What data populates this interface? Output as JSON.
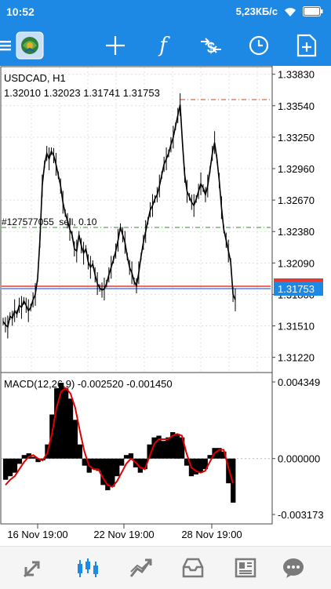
{
  "status_bar": {
    "time": "10:52",
    "network_speed": "5,23КБ/с",
    "battery": "full"
  },
  "toolbar": {
    "icons": [
      "menu-icon",
      "app-logo-icon",
      "crosshair-icon",
      "indicators-icon",
      "trade-icon",
      "clock-icon",
      "new-order-icon"
    ],
    "color": "#1e88e5"
  },
  "chart": {
    "symbol_label": "USDCAD, H1",
    "ohlc_label": "1.32010 1.32023 1.31741 1.31753",
    "order_label": "#127577055  sell, 0.10",
    "price_axis_labels": [
      "1.33830",
      "1.33540",
      "1.33250",
      "1.32960",
      "1.32670",
      "1.32380",
      "1.32090",
      "1.31800",
      "1.31510",
      "1.31220"
    ],
    "current_price": "1.31753",
    "macd_label": "MACD(12,26,9) -0.002520 -0.001450",
    "macd_axis_labels": [
      "0.004349",
      "0.000000",
      "-0.003173"
    ],
    "time_labels": [
      "16 Nov 19:00",
      "22 Nov 19:00",
      "28 Nov 19:00"
    ],
    "colors": {
      "price_line": "#000000",
      "bid_line": "#e53935",
      "ask_line": "#5c7cfa",
      "current_price_bg": "#1e88e5",
      "signal_line": "#e00000",
      "order_line": "#2e8b2e",
      "sl_tp_line": "#d04020"
    }
  },
  "chart_data": [
    {
      "type": "line",
      "title": "USDCAD, H1",
      "xlabel": "",
      "ylabel": "",
      "x_tick_labels": [
        "16 Nov 19:00",
        "22 Nov 19:00",
        "28 Nov 19:00"
      ],
      "ylim": [
        1.3108,
        1.339
      ],
      "series": [
        {
          "values": [
            1.3155,
            1.3152,
            1.315,
            1.316,
            1.3158,
            1.3165,
            1.3162,
            1.317,
            1.3168,
            1.3174,
            1.317,
            1.3165,
            1.3168,
            1.3175,
            1.318,
            1.3195,
            1.323,
            1.328,
            1.33,
            1.331,
            1.3305,
            1.3312,
            1.3308,
            1.33,
            1.329,
            1.328,
            1.3265,
            1.3255,
            1.3248,
            1.324,
            1.3235,
            1.3222,
            1.322,
            1.3235,
            1.3225,
            1.3218,
            1.3222,
            1.321,
            1.3205,
            1.3208,
            1.3198,
            1.319,
            1.3186,
            1.3184,
            1.3185,
            1.319,
            1.3198,
            1.3205,
            1.3212,
            1.322,
            1.323,
            1.3242,
            1.3235,
            1.3228,
            1.3215,
            1.3205,
            1.32,
            1.3192,
            1.3188,
            1.32,
            1.3215,
            1.3228,
            1.3238,
            1.3248,
            1.3258,
            1.3262,
            1.3268,
            1.3272,
            1.328,
            1.329,
            1.33,
            1.3305,
            1.331,
            1.3318,
            1.3325,
            1.3335,
            1.3345,
            1.3355,
            1.332,
            1.329,
            1.3275,
            1.327,
            1.3265,
            1.3262,
            1.3268,
            1.3275,
            1.3282,
            1.3278,
            1.3272,
            1.328,
            1.3295,
            1.331,
            1.332,
            1.3305,
            1.3285,
            1.326,
            1.324,
            1.323,
            1.322,
            1.321,
            1.318,
            1.3175
          ]
        }
      ]
    },
    {
      "type": "bar",
      "title": "MACD(12,26,9)",
      "xlabel": "",
      "ylabel": "",
      "ylim": [
        -0.003173,
        0.004349
      ],
      "series": [
        {
          "name": "MACD",
          "values": [
            -0.0012,
            -0.001,
            -0.0008,
            -0.0003,
            0.0002,
            0.0003,
            0.0001,
            -0.0002,
            -0.0001,
            0.0008,
            0.0025,
            0.004,
            0.0043,
            0.004,
            0.0034,
            0.0022,
            0.0008,
            -0.0004,
            -0.0008,
            -0.0006,
            -0.0007,
            -0.0015,
            -0.0018,
            -0.0016,
            -0.001,
            -0.0004,
            0.0002,
            0.0003,
            -0.0005,
            -0.0008,
            -0.0006,
            0.0008,
            0.0012,
            0.0013,
            0.001,
            0.0012,
            0.0015,
            0.0014,
            0.0012,
            -0.0004,
            -0.001,
            -0.0009,
            -0.0008,
            -0.0006,
            0.0002,
            0.0006,
            0.0006,
            0.0004,
            -0.0014,
            -0.0025
          ]
        },
        {
          "name": "Signal",
          "values": [
            -0.0015,
            -0.0012,
            -0.001,
            -0.0006,
            -0.0002,
            0.0001,
            0.0002,
            0.0,
            -0.0001,
            0.0003,
            0.0014,
            0.0029,
            0.0038,
            0.004,
            0.0037,
            0.0029,
            0.0016,
            0.0004,
            -0.0004,
            -0.0006,
            -0.0006,
            -0.0011,
            -0.0015,
            -0.0016,
            -0.0013,
            -0.0008,
            -0.0003,
            0.0,
            -0.0002,
            -0.0005,
            -0.0006,
            0.0001,
            0.0008,
            0.0011,
            0.0011,
            0.0011,
            0.0013,
            0.0014,
            0.0013,
            0.0003,
            -0.0005,
            -0.0007,
            -0.0008,
            -0.0007,
            -0.0002,
            0.0003,
            0.0005,
            0.0005,
            -0.0005,
            -0.0014
          ]
        }
      ]
    }
  ],
  "bottom_nav": {
    "items": [
      "quotes-icon",
      "chart-icon",
      "trade-icon",
      "history-icon",
      "news-icon",
      "chat-icon"
    ],
    "active": "chart-icon",
    "active_color": "#1e88e5",
    "inactive_color": "#7a7a7a"
  }
}
